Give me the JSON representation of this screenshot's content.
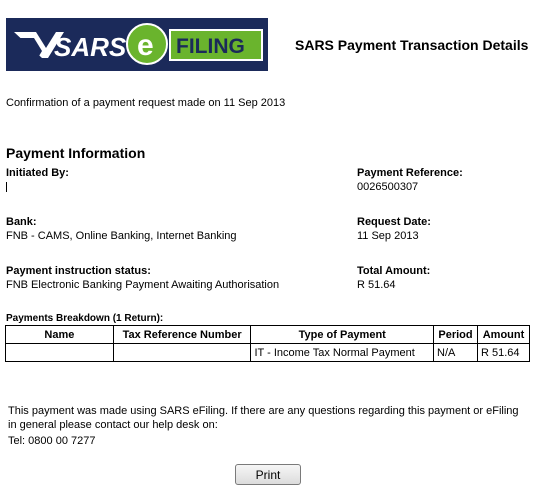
{
  "header": {
    "logo_text": "SARS eFILING",
    "title": "SARS Payment Transaction Details"
  },
  "confirmation": "Confirmation of a payment request made on 11 Sep 2013",
  "payment_info": {
    "section_title": "Payment Information",
    "initiated_by_label": "Initiated By:",
    "initiated_by_value": "",
    "payment_reference_label": "Payment Reference:",
    "payment_reference_value": "0026500307",
    "bank_label": "Bank:",
    "bank_value": "FNB - CAMS, Online Banking, Internet Banking",
    "request_date_label": "Request Date:",
    "request_date_value": "11 Sep 2013",
    "status_label": "Payment instruction status:",
    "status_value": "FNB Electronic Banking Payment Awaiting Authorisation",
    "total_amount_label": "Total Amount:",
    "total_amount_value": "R 51.64"
  },
  "breakdown": {
    "title": "Payments Breakdown (1 Return):",
    "headers": [
      "Name",
      "Tax Reference Number",
      "Type of Payment",
      "Period",
      "Amount"
    ],
    "rows": [
      [
        "",
        "",
        "IT - Income Tax Normal Payment",
        "N/A",
        "R 51.64"
      ]
    ]
  },
  "footer": {
    "message": "This payment was made using SARS eFiling. If there are any questions regarding this payment or eFiling in general please contact our help desk on:",
    "tel": "Tel: 0800 00 7277"
  },
  "print_button": "Print",
  "colors": {
    "logo_bg": "#1b2a5a",
    "logo_green": "#6ab42d"
  }
}
